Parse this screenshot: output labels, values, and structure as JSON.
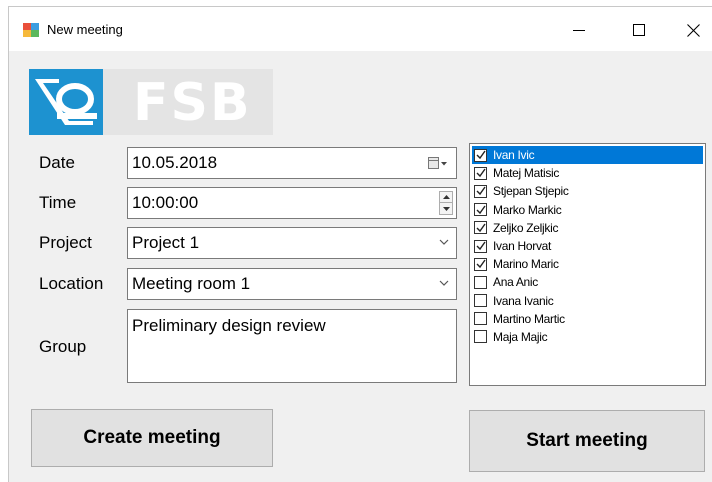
{
  "window": {
    "title": "New meeting",
    "minimize_symbol": "—",
    "maximize_symbol": "□",
    "close_symbol": "✕"
  },
  "logo": {
    "text": "FSB"
  },
  "form": {
    "date": {
      "label": "Date",
      "value": "10.05.2018"
    },
    "time": {
      "label": "Time",
      "value": "10:00:00"
    },
    "project": {
      "label": "Project",
      "value": "Project 1"
    },
    "location": {
      "label": "Location",
      "value": "Meeting room 1"
    },
    "group": {
      "label": "Group",
      "value": "Preliminary design review"
    }
  },
  "participants": [
    {
      "name": "Ivan Ivic",
      "checked": true,
      "selected": true
    },
    {
      "name": "Matej Matisic",
      "checked": true,
      "selected": false
    },
    {
      "name": "Stjepan Stjepic",
      "checked": true,
      "selected": false
    },
    {
      "name": "Marko Markic",
      "checked": true,
      "selected": false
    },
    {
      "name": "Zeljko Zeljkic",
      "checked": true,
      "selected": false
    },
    {
      "name": "Ivan Horvat",
      "checked": true,
      "selected": false
    },
    {
      "name": "Marino Maric",
      "checked": true,
      "selected": false
    },
    {
      "name": "Ana Anic",
      "checked": false,
      "selected": false
    },
    {
      "name": "Ivana Ivanic",
      "checked": false,
      "selected": false
    },
    {
      "name": "Martino Martic",
      "checked": false,
      "selected": false
    },
    {
      "name": "Maja Majic",
      "checked": false,
      "selected": false
    }
  ],
  "buttons": {
    "create": "Create meeting",
    "start": "Start meeting"
  },
  "colors": {
    "accent": "#1d92d0",
    "selection": "#0078d7",
    "button_face": "#e1e1e1"
  }
}
